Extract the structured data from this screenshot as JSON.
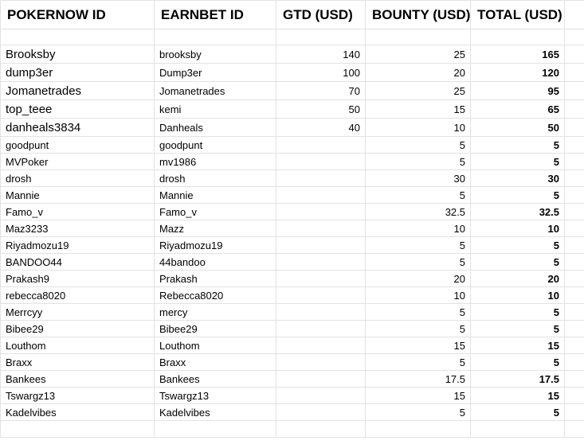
{
  "headers": [
    "POKERNOW ID",
    "EARNBET ID",
    "GTD (USD)",
    "BOUNTY (USD)",
    "TOTAL (USD)"
  ],
  "rows": [
    {
      "pokernow": "Brooksby",
      "earnbet": "brooksby",
      "gtd": "140",
      "bounty": "25",
      "total": "165"
    },
    {
      "pokernow": "dump3er",
      "earnbet": "Dump3er",
      "gtd": "100",
      "bounty": "20",
      "total": "120"
    },
    {
      "pokernow": "Jomanetrades",
      "earnbet": "Jomanetrades",
      "gtd": "70",
      "bounty": "25",
      "total": "95"
    },
    {
      "pokernow": "top_teee",
      "earnbet": "kemi",
      "gtd": "50",
      "bounty": "15",
      "total": "65"
    },
    {
      "pokernow": "danheals3834",
      "earnbet": "Danheals",
      "gtd": "40",
      "bounty": "10",
      "total": "50"
    },
    {
      "pokernow": "goodpunt",
      "earnbet": "goodpunt",
      "gtd": "",
      "bounty": "5",
      "total": "5"
    },
    {
      "pokernow": "MVPoker",
      "earnbet": "mv1986",
      "gtd": "",
      "bounty": "5",
      "total": "5"
    },
    {
      "pokernow": "drosh",
      "earnbet": "drosh",
      "gtd": "",
      "bounty": "30",
      "total": "30"
    },
    {
      "pokernow": "Mannie",
      "earnbet": "Mannie",
      "gtd": "",
      "bounty": "5",
      "total": "5"
    },
    {
      "pokernow": "Famo_v",
      "earnbet": "Famo_v",
      "gtd": "",
      "bounty": "32.5",
      "total": "32.5"
    },
    {
      "pokernow": "Maz3233",
      "earnbet": "Mazz",
      "gtd": "",
      "bounty": "10",
      "total": "10"
    },
    {
      "pokernow": "Riyadmozu19",
      "earnbet": "Riyadmozu19",
      "gtd": "",
      "bounty": "5",
      "total": "5"
    },
    {
      "pokernow": "BANDOO44",
      "earnbet": "44bandoo",
      "gtd": "",
      "bounty": "5",
      "total": "5"
    },
    {
      "pokernow": "Prakash9",
      "earnbet": "Prakash",
      "gtd": "",
      "bounty": "20",
      "total": "20"
    },
    {
      "pokernow": "rebecca8020",
      "earnbet": "Rebecca8020",
      "gtd": "",
      "bounty": "10",
      "total": "10"
    },
    {
      "pokernow": "Merrcyy",
      "earnbet": "mercy",
      "gtd": "",
      "bounty": "5",
      "total": "5"
    },
    {
      "pokernow": "Bibee29",
      "earnbet": "Bibee29",
      "gtd": "",
      "bounty": "5",
      "total": "5"
    },
    {
      "pokernow": "Louthom",
      "earnbet": "Louthom",
      "gtd": "",
      "bounty": "15",
      "total": "15"
    },
    {
      "pokernow": "Braxx",
      "earnbet": "Braxx",
      "gtd": "",
      "bounty": "5",
      "total": "5"
    },
    {
      "pokernow": "Bankees",
      "earnbet": "Bankees",
      "gtd": "",
      "bounty": "17.5",
      "total": "17.5"
    },
    {
      "pokernow": "Tswargz13",
      "earnbet": "Tswargz13",
      "gtd": "",
      "bounty": "15",
      "total": "15"
    },
    {
      "pokernow": "Kadelvibes",
      "earnbet": "Kadelvibes",
      "gtd": "",
      "bounty": "5",
      "total": "5"
    }
  ]
}
